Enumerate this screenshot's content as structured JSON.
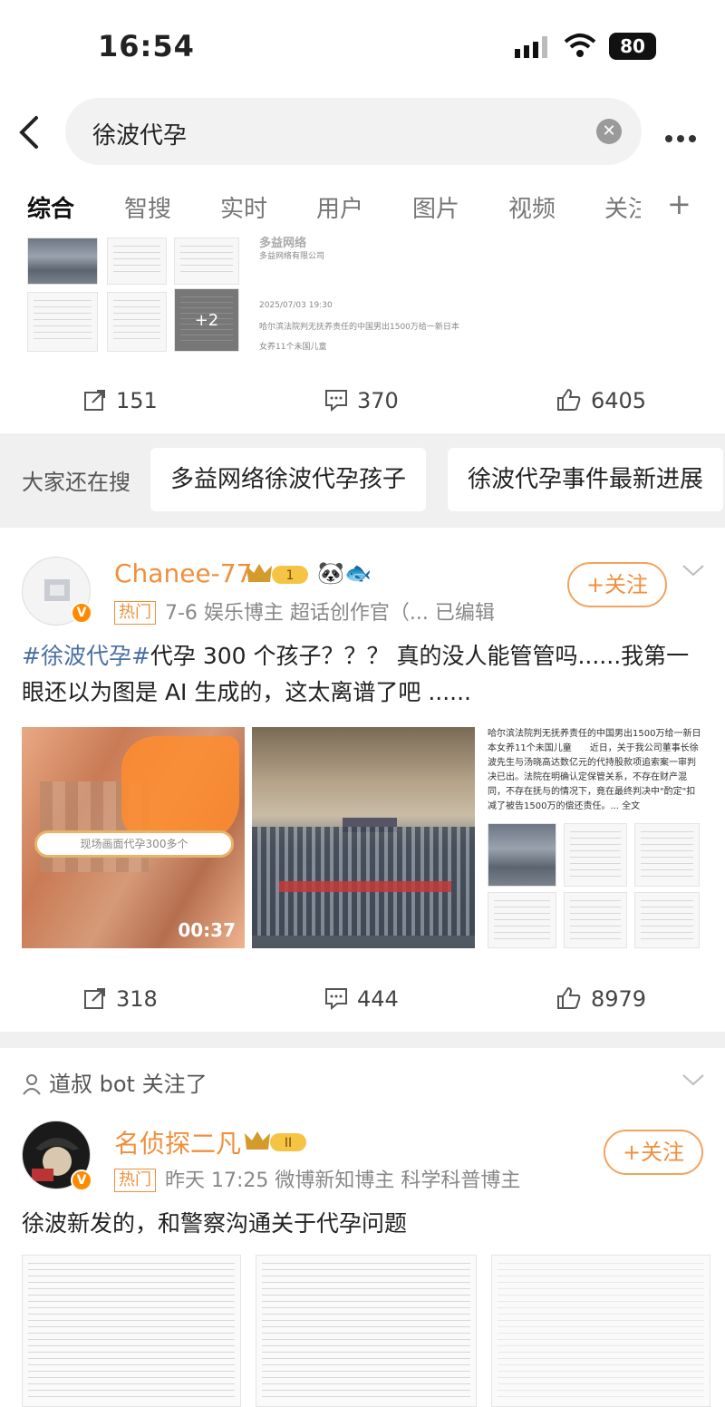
{
  "status_bar": {
    "time": "16:54",
    "battery": "80"
  },
  "search": {
    "query": "徐波代孕"
  },
  "tabs": [
    {
      "label": "综合"
    },
    {
      "label": "智搜"
    },
    {
      "label": "实时"
    },
    {
      "label": "用户"
    },
    {
      "label": "图片"
    },
    {
      "label": "视频"
    },
    {
      "label": "关注"
    }
  ],
  "tab_plus": "+",
  "post1": {
    "doc_lines": [
      "多益网络",
      "多益网络有限公司",
      "2025/07/03 19:30",
      "哈尔滨法院判无抚养责任的中国男出1500万给一新日本",
      "女养11个未国儿童"
    ],
    "more_images": "+2",
    "reposts": "151",
    "comments": "370",
    "likes": "6405"
  },
  "also_search": {
    "label": "大家还在搜",
    "chips": [
      "多益网络徐波代孕孩子",
      "徐波代孕事件最新进展"
    ]
  },
  "post2": {
    "username": "Chanee-77",
    "level": "1",
    "hot_label": "热门",
    "meta": "7-6  娱乐博主 超话创作官（...  已编辑",
    "follow": "+关注",
    "hashtag": "#徐波代孕#",
    "text_rest": "代孕 300 个孩子？？？ 真的没人能管管吗......我第一眼还以为图是 AI 生成的，这太离谱了吧 ......",
    "video_banner": "现场画面代孕300多个",
    "video_duration": "00:37",
    "doc_text": "哈尔滨法院判无抚养责任的中国男出1500万给一新日本女养11个未国儿童　　近日，关于我公司董事长徐波先生与汤晓高达数亿元的代持股款项追索案一审判决已出。法院在明确认定保管关系，不存在财产混同，不存在抚与的情况下，竟在最终判决中\"酌定\"扣减了被告1500万的偿还责任。... 全文",
    "reposts": "318",
    "comments": "444",
    "likes": "8979"
  },
  "follow_note": "道叔 bot 关注了",
  "post3": {
    "username": "名侦探二凡",
    "level": "II",
    "hot_label": "热门",
    "meta": "昨天 17:25  微博新知博主 科学科普博主",
    "follow": "+关注",
    "text": "徐波新发的，和警察沟通关于代孕问题"
  },
  "colors": {
    "accent": "#f08f3c",
    "hashtag": "#4a6fa5",
    "gray_bg": "#f0f0f0"
  }
}
